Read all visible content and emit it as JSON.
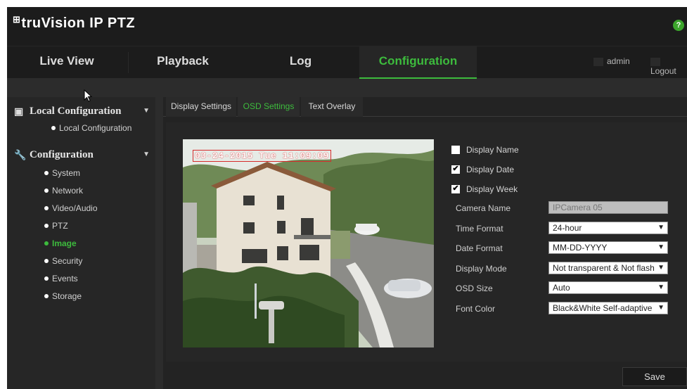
{
  "header": {
    "logo_mark": "⊞",
    "logo_text": "truVision IP PTZ",
    "help_icon": "?"
  },
  "nav": {
    "tabs": [
      {
        "label": "Live View"
      },
      {
        "label": "Playback"
      },
      {
        "label": "Log"
      },
      {
        "label": "Configuration",
        "active": true
      }
    ],
    "user": "admin",
    "logout": "Logout"
  },
  "sidebar": {
    "groups": [
      {
        "label": "Local Configuration",
        "icon": "local-config-icon",
        "items": [
          {
            "label": "Local Configuration"
          }
        ]
      },
      {
        "label": "Configuration",
        "icon": "wrench-icon",
        "items": [
          {
            "label": "System"
          },
          {
            "label": "Network"
          },
          {
            "label": "Video/Audio"
          },
          {
            "label": "PTZ"
          },
          {
            "label": "Image",
            "active": true
          },
          {
            "label": "Security"
          },
          {
            "label": "Events"
          },
          {
            "label": "Storage"
          }
        ]
      }
    ]
  },
  "subtabs": [
    {
      "label": "Display Settings"
    },
    {
      "label": "OSD Settings",
      "active": true
    },
    {
      "label": "Text Overlay"
    }
  ],
  "video": {
    "osd_text": "03-24-2015 Tue 11:09:09"
  },
  "settings": {
    "checkboxes": [
      {
        "label": "Display Name",
        "checked": false
      },
      {
        "label": "Display Date",
        "checked": true
      },
      {
        "label": "Display Week",
        "checked": true
      }
    ],
    "fields": {
      "camera_name": {
        "label": "Camera Name",
        "value": "IPCamera 05"
      },
      "time_format": {
        "label": "Time Format",
        "value": "24-hour"
      },
      "date_format": {
        "label": "Date Format",
        "value": "MM-DD-YYYY"
      },
      "display_mode": {
        "label": "Display Mode",
        "value": "Not transparent & Not flash"
      },
      "osd_size": {
        "label": "OSD Size",
        "value": "Auto"
      },
      "font_color": {
        "label": "Font Color",
        "value": "Black&White Self-adaptive"
      }
    }
  },
  "actions": {
    "save": "Save"
  },
  "colors": {
    "accent_green": "#3dbb3d",
    "osd_border_red": "#d62b2b",
    "background_dark": "#2c2c2c"
  }
}
